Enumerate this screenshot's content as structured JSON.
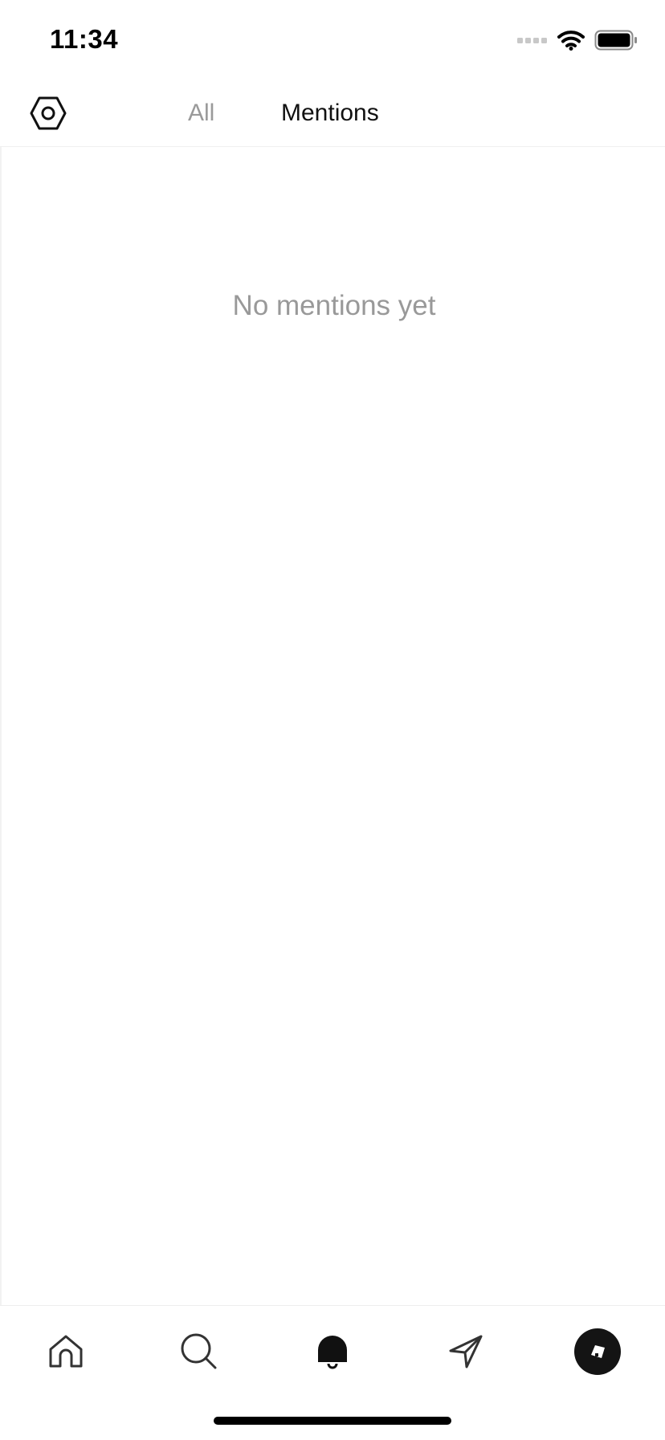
{
  "status_bar": {
    "time": "11:34",
    "icons": [
      "signal-icon",
      "wifi-icon",
      "battery-icon"
    ]
  },
  "header": {
    "settings_icon": "hexagon-settings-icon",
    "tabs": [
      {
        "label": "All",
        "active": false
      },
      {
        "label": "Mentions",
        "active": true
      }
    ]
  },
  "main": {
    "empty_message": "No mentions yet"
  },
  "tab_bar": {
    "items": [
      {
        "icon": "home-icon"
      },
      {
        "icon": "search-icon"
      },
      {
        "icon": "bell-icon",
        "active": true
      },
      {
        "icon": "send-icon"
      },
      {
        "icon": "profile-icon"
      }
    ]
  },
  "colors": {
    "active_text": "#111111",
    "inactive_text": "#9a9a9a",
    "empty_text": "#999999",
    "background": "#ffffff"
  }
}
